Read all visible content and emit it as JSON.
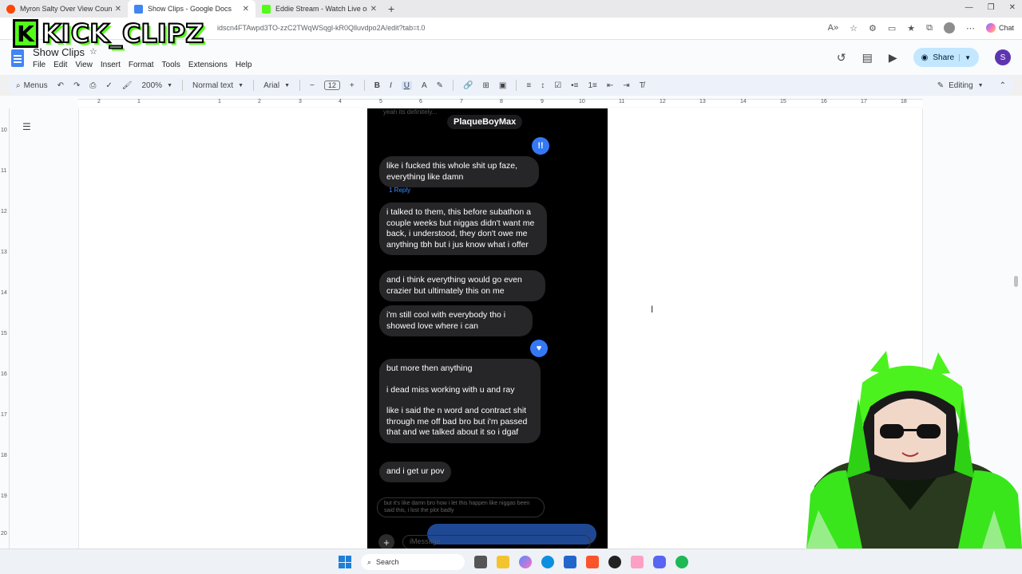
{
  "browser": {
    "tabs": [
      {
        "title": "Myron Salty Over View Count : r/...",
        "favicon_color": "#ff4500",
        "active": false
      },
      {
        "title": "Show Clips - Google Docs",
        "favicon_color": "#4285f4",
        "active": true
      },
      {
        "title": "Eddie Stream - Watch Live on Kick",
        "favicon_color": "#53fc18",
        "active": false
      }
    ],
    "new_tab": "+",
    "url": "idscn4FTAwpd3TO-zzC2TWqWSqgl-kR0Qlluvdpo2A/edit?tab=t.0",
    "chat_label": "Chat"
  },
  "overlay": {
    "logo_badge": "K",
    "logo_text": "KICK_CLIPZ"
  },
  "docs": {
    "title": "Show Clips",
    "menu": [
      "File",
      "Edit",
      "View",
      "Insert",
      "Format",
      "Tools",
      "Extensions",
      "Help"
    ],
    "share_label": "Share",
    "user_initial": "S",
    "toolbar": {
      "search_label": "Menus",
      "zoom": "200%",
      "style": "Normal text",
      "font": "Arial",
      "font_size": "12",
      "bold": "B",
      "italic": "I",
      "underline": "U",
      "mode": "Editing"
    },
    "ruler_numbers": [
      "2",
      "1",
      "1",
      "2",
      "3",
      "4",
      "5",
      "6",
      "7",
      "8",
      "9",
      "10",
      "11",
      "12",
      "13",
      "14",
      "15",
      "16",
      "17",
      "18"
    ],
    "vruler_numbers": [
      "10",
      "11",
      "12",
      "13",
      "14",
      "15",
      "16",
      "17",
      "18",
      "19",
      "20"
    ]
  },
  "phone": {
    "cut_text": "yeah its definitely...",
    "contact_name": "PlaqueBoyMax",
    "reaction1": "!!",
    "reaction2": "♥",
    "messages": [
      {
        "id": "m1",
        "paras": [
          "like i fucked this whole shit up faze, everything like damn"
        ]
      },
      {
        "id": "m2",
        "paras": [
          "i talked to them, this before subathon a couple weeks but niggas didn't want me back, i understood, they don't owe me anything tbh but i jus know what i offer"
        ]
      },
      {
        "id": "m3",
        "paras": [
          "and i think everything would go even crazier but ultimately this on me"
        ]
      },
      {
        "id": "m4",
        "paras": [
          "i'm still cool with everybody tho i showed love where i can"
        ]
      },
      {
        "id": "m5",
        "paras": [
          "but more then anything",
          "i dead miss working with u and ray",
          "like i said the n word and contract shit through me off bad bro but i'm passed that and we talked about it so i dgaf"
        ]
      },
      {
        "id": "m6",
        "paras": [
          "and i get ur pov"
        ]
      }
    ],
    "reply_link": "1 Reply",
    "faint_reply": "but it's like damn bro how i let this happen like niggas been said this, i lost the plot badly",
    "input_placeholder": "iMessage",
    "plus": "+"
  },
  "taskbar": {
    "search_label": "Search",
    "apps": [
      "file-explorer",
      "copilot",
      "edge",
      "store",
      "brave",
      "obs",
      "vtube-app",
      "discord",
      "spotify"
    ]
  },
  "colors": {
    "kick_green": "#53fc18",
    "imessage_blue": "#3478f6",
    "docs_blue": "#4285f4",
    "share_bg": "#c2e7ff"
  }
}
